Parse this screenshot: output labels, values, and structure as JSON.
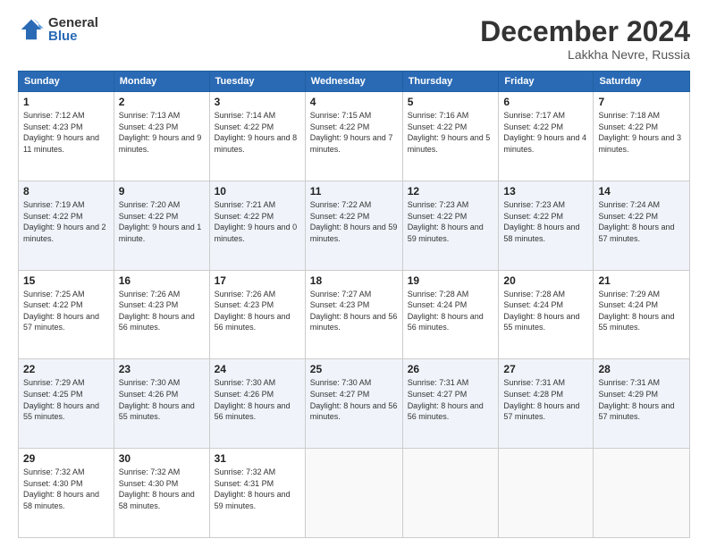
{
  "header": {
    "logo_general": "General",
    "logo_blue": "Blue",
    "month_title": "December 2024",
    "location": "Lakkha Nevre, Russia"
  },
  "calendar": {
    "days_of_week": [
      "Sunday",
      "Monday",
      "Tuesday",
      "Wednesday",
      "Thursday",
      "Friday",
      "Saturday"
    ],
    "weeks": [
      [
        {
          "day": "1",
          "sunrise": "7:12 AM",
          "sunset": "4:23 PM",
          "daylight": "9 hours and 11 minutes."
        },
        {
          "day": "2",
          "sunrise": "7:13 AM",
          "sunset": "4:23 PM",
          "daylight": "9 hours and 9 minutes."
        },
        {
          "day": "3",
          "sunrise": "7:14 AM",
          "sunset": "4:22 PM",
          "daylight": "9 hours and 8 minutes."
        },
        {
          "day": "4",
          "sunrise": "7:15 AM",
          "sunset": "4:22 PM",
          "daylight": "9 hours and 7 minutes."
        },
        {
          "day": "5",
          "sunrise": "7:16 AM",
          "sunset": "4:22 PM",
          "daylight": "9 hours and 5 minutes."
        },
        {
          "day": "6",
          "sunrise": "7:17 AM",
          "sunset": "4:22 PM",
          "daylight": "9 hours and 4 minutes."
        },
        {
          "day": "7",
          "sunrise": "7:18 AM",
          "sunset": "4:22 PM",
          "daylight": "9 hours and 3 minutes."
        }
      ],
      [
        {
          "day": "8",
          "sunrise": "7:19 AM",
          "sunset": "4:22 PM",
          "daylight": "9 hours and 2 minutes."
        },
        {
          "day": "9",
          "sunrise": "7:20 AM",
          "sunset": "4:22 PM",
          "daylight": "9 hours and 1 minute."
        },
        {
          "day": "10",
          "sunrise": "7:21 AM",
          "sunset": "4:22 PM",
          "daylight": "9 hours and 0 minutes."
        },
        {
          "day": "11",
          "sunrise": "7:22 AM",
          "sunset": "4:22 PM",
          "daylight": "8 hours and 59 minutes."
        },
        {
          "day": "12",
          "sunrise": "7:23 AM",
          "sunset": "4:22 PM",
          "daylight": "8 hours and 59 minutes."
        },
        {
          "day": "13",
          "sunrise": "7:23 AM",
          "sunset": "4:22 PM",
          "daylight": "8 hours and 58 minutes."
        },
        {
          "day": "14",
          "sunrise": "7:24 AM",
          "sunset": "4:22 PM",
          "daylight": "8 hours and 57 minutes."
        }
      ],
      [
        {
          "day": "15",
          "sunrise": "7:25 AM",
          "sunset": "4:22 PM",
          "daylight": "8 hours and 57 minutes."
        },
        {
          "day": "16",
          "sunrise": "7:26 AM",
          "sunset": "4:23 PM",
          "daylight": "8 hours and 56 minutes."
        },
        {
          "day": "17",
          "sunrise": "7:26 AM",
          "sunset": "4:23 PM",
          "daylight": "8 hours and 56 minutes."
        },
        {
          "day": "18",
          "sunrise": "7:27 AM",
          "sunset": "4:23 PM",
          "daylight": "8 hours and 56 minutes."
        },
        {
          "day": "19",
          "sunrise": "7:28 AM",
          "sunset": "4:24 PM",
          "daylight": "8 hours and 56 minutes."
        },
        {
          "day": "20",
          "sunrise": "7:28 AM",
          "sunset": "4:24 PM",
          "daylight": "8 hours and 55 minutes."
        },
        {
          "day": "21",
          "sunrise": "7:29 AM",
          "sunset": "4:24 PM",
          "daylight": "8 hours and 55 minutes."
        }
      ],
      [
        {
          "day": "22",
          "sunrise": "7:29 AM",
          "sunset": "4:25 PM",
          "daylight": "8 hours and 55 minutes."
        },
        {
          "day": "23",
          "sunrise": "7:30 AM",
          "sunset": "4:26 PM",
          "daylight": "8 hours and 55 minutes."
        },
        {
          "day": "24",
          "sunrise": "7:30 AM",
          "sunset": "4:26 PM",
          "daylight": "8 hours and 56 minutes."
        },
        {
          "day": "25",
          "sunrise": "7:30 AM",
          "sunset": "4:27 PM",
          "daylight": "8 hours and 56 minutes."
        },
        {
          "day": "26",
          "sunrise": "7:31 AM",
          "sunset": "4:27 PM",
          "daylight": "8 hours and 56 minutes."
        },
        {
          "day": "27",
          "sunrise": "7:31 AM",
          "sunset": "4:28 PM",
          "daylight": "8 hours and 57 minutes."
        },
        {
          "day": "28",
          "sunrise": "7:31 AM",
          "sunset": "4:29 PM",
          "daylight": "8 hours and 57 minutes."
        }
      ],
      [
        {
          "day": "29",
          "sunrise": "7:32 AM",
          "sunset": "4:30 PM",
          "daylight": "8 hours and 58 minutes."
        },
        {
          "day": "30",
          "sunrise": "7:32 AM",
          "sunset": "4:30 PM",
          "daylight": "8 hours and 58 minutes."
        },
        {
          "day": "31",
          "sunrise": "7:32 AM",
          "sunset": "4:31 PM",
          "daylight": "8 hours and 59 minutes."
        },
        null,
        null,
        null,
        null
      ]
    ]
  }
}
